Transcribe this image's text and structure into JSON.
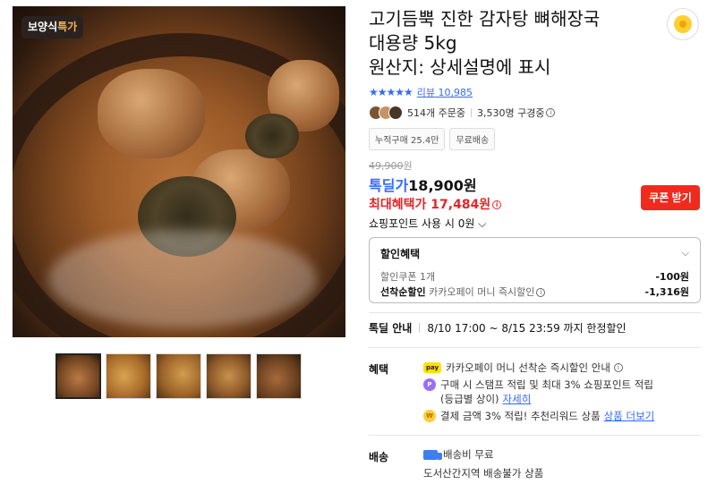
{
  "gallery": {
    "badge_prefix": "보양식",
    "badge_highlight": "특가",
    "thumbnails": [
      "thumb-1",
      "thumb-2",
      "thumb-3",
      "thumb-4",
      "thumb-5"
    ]
  },
  "product": {
    "title_line1": "고기듬뿍 진한 감자탕 뼈해장국",
    "title_line2": "대용량 5kg",
    "title_line3": "원산지: 상세설명에 표시",
    "stars": "★★★★★",
    "rating_fraction": 0.9,
    "review_label": "리뷰",
    "review_count": "10,985",
    "orders": "514개 주문중",
    "subscribers": "3,530명 구경중",
    "chips": [
      "누적구매 25.4만",
      "무료배송"
    ]
  },
  "price": {
    "original": "49,900",
    "original_unit": "원",
    "deal_label": "톡딜가",
    "deal_price": "18,900원",
    "max_label": "최대혜택가",
    "max_price": "17,484원",
    "coupon_button": "쿠폰 받기",
    "point_text": "쇼핑포인트 사용 시 0원",
    "point_chevron": "⌵"
  },
  "discount": {
    "title": "할인혜택",
    "chevron": "⌵",
    "line1_label": "할인쿠폰 1개",
    "line1_value": "-100원",
    "line2_bold": "선착순할인",
    "line2_label": " 카카오페이 머니 즉시할인",
    "line2_value": "-1,316원"
  },
  "today_deal": {
    "label": "톡딜 안내",
    "period": "8/10 17:00 ~ 8/15 23:59 까지 한정할인"
  },
  "benefits": {
    "label": "혜택",
    "items": [
      {
        "icon": "pay",
        "text": "카카오페이 머니 선착순 즉시할인 안내"
      },
      {
        "icon": "P",
        "text": "구매 시 스탬프 적립 및 최대 3% 쇼핑포인트 적립",
        "text2": "(등급별 상이)",
        "link": "자세히"
      },
      {
        "icon": "coin",
        "text": "결제 금액 3% 적립! 추천리워드 상품",
        "link": "상품 더보기"
      }
    ]
  },
  "shipping": {
    "label": "배송",
    "fee": "배송비 무료",
    "note": "도서산간지역 배송불가 상품"
  },
  "colors": {
    "accent_blue": "#346aff",
    "sale_red": "#e52528",
    "coupon_red": "#f02b1e",
    "kakao_yellow": "#ffe100"
  }
}
